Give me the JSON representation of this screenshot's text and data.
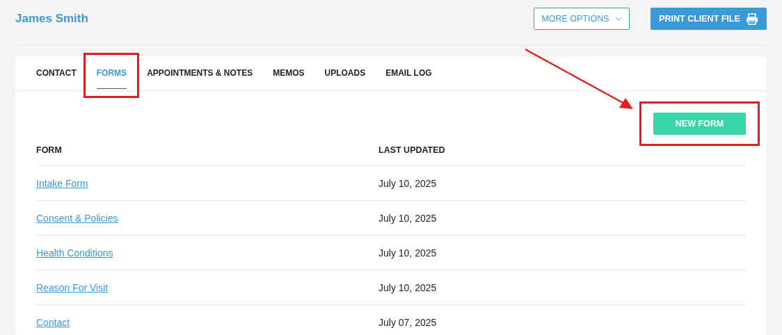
{
  "header": {
    "client_name": "James Smith",
    "more_options": "MORE OPTIONS",
    "print_button": "PRINT CLIENT FILE"
  },
  "tabs": [
    {
      "label": "CONTACT",
      "selected": false,
      "highlighted": false
    },
    {
      "label": "FORMS",
      "selected": true,
      "highlighted": true
    },
    {
      "label": "APPOINTMENTS & NOTES",
      "selected": false,
      "highlighted": false
    },
    {
      "label": "MEMOS",
      "selected": false,
      "highlighted": false
    },
    {
      "label": "UPLOADS",
      "selected": false,
      "highlighted": false
    },
    {
      "label": "EMAIL LOG",
      "selected": false,
      "highlighted": false
    }
  ],
  "new_form_button": {
    "label": "NEW FORM",
    "highlighted": true,
    "arrow": true
  },
  "table": {
    "columns": [
      "FORM",
      "LAST UPDATED"
    ],
    "rows": [
      {
        "form": "Intake Form",
        "last_updated": "July 10, 2025"
      },
      {
        "form": "Consent & Policies",
        "last_updated": "July 10, 2025"
      },
      {
        "form": "Health Conditions",
        "last_updated": "July 10, 2025"
      },
      {
        "form": "Reason For Visit",
        "last_updated": "July 10, 2025"
      },
      {
        "form": "Contact",
        "last_updated": "July 07, 2025"
      }
    ]
  }
}
